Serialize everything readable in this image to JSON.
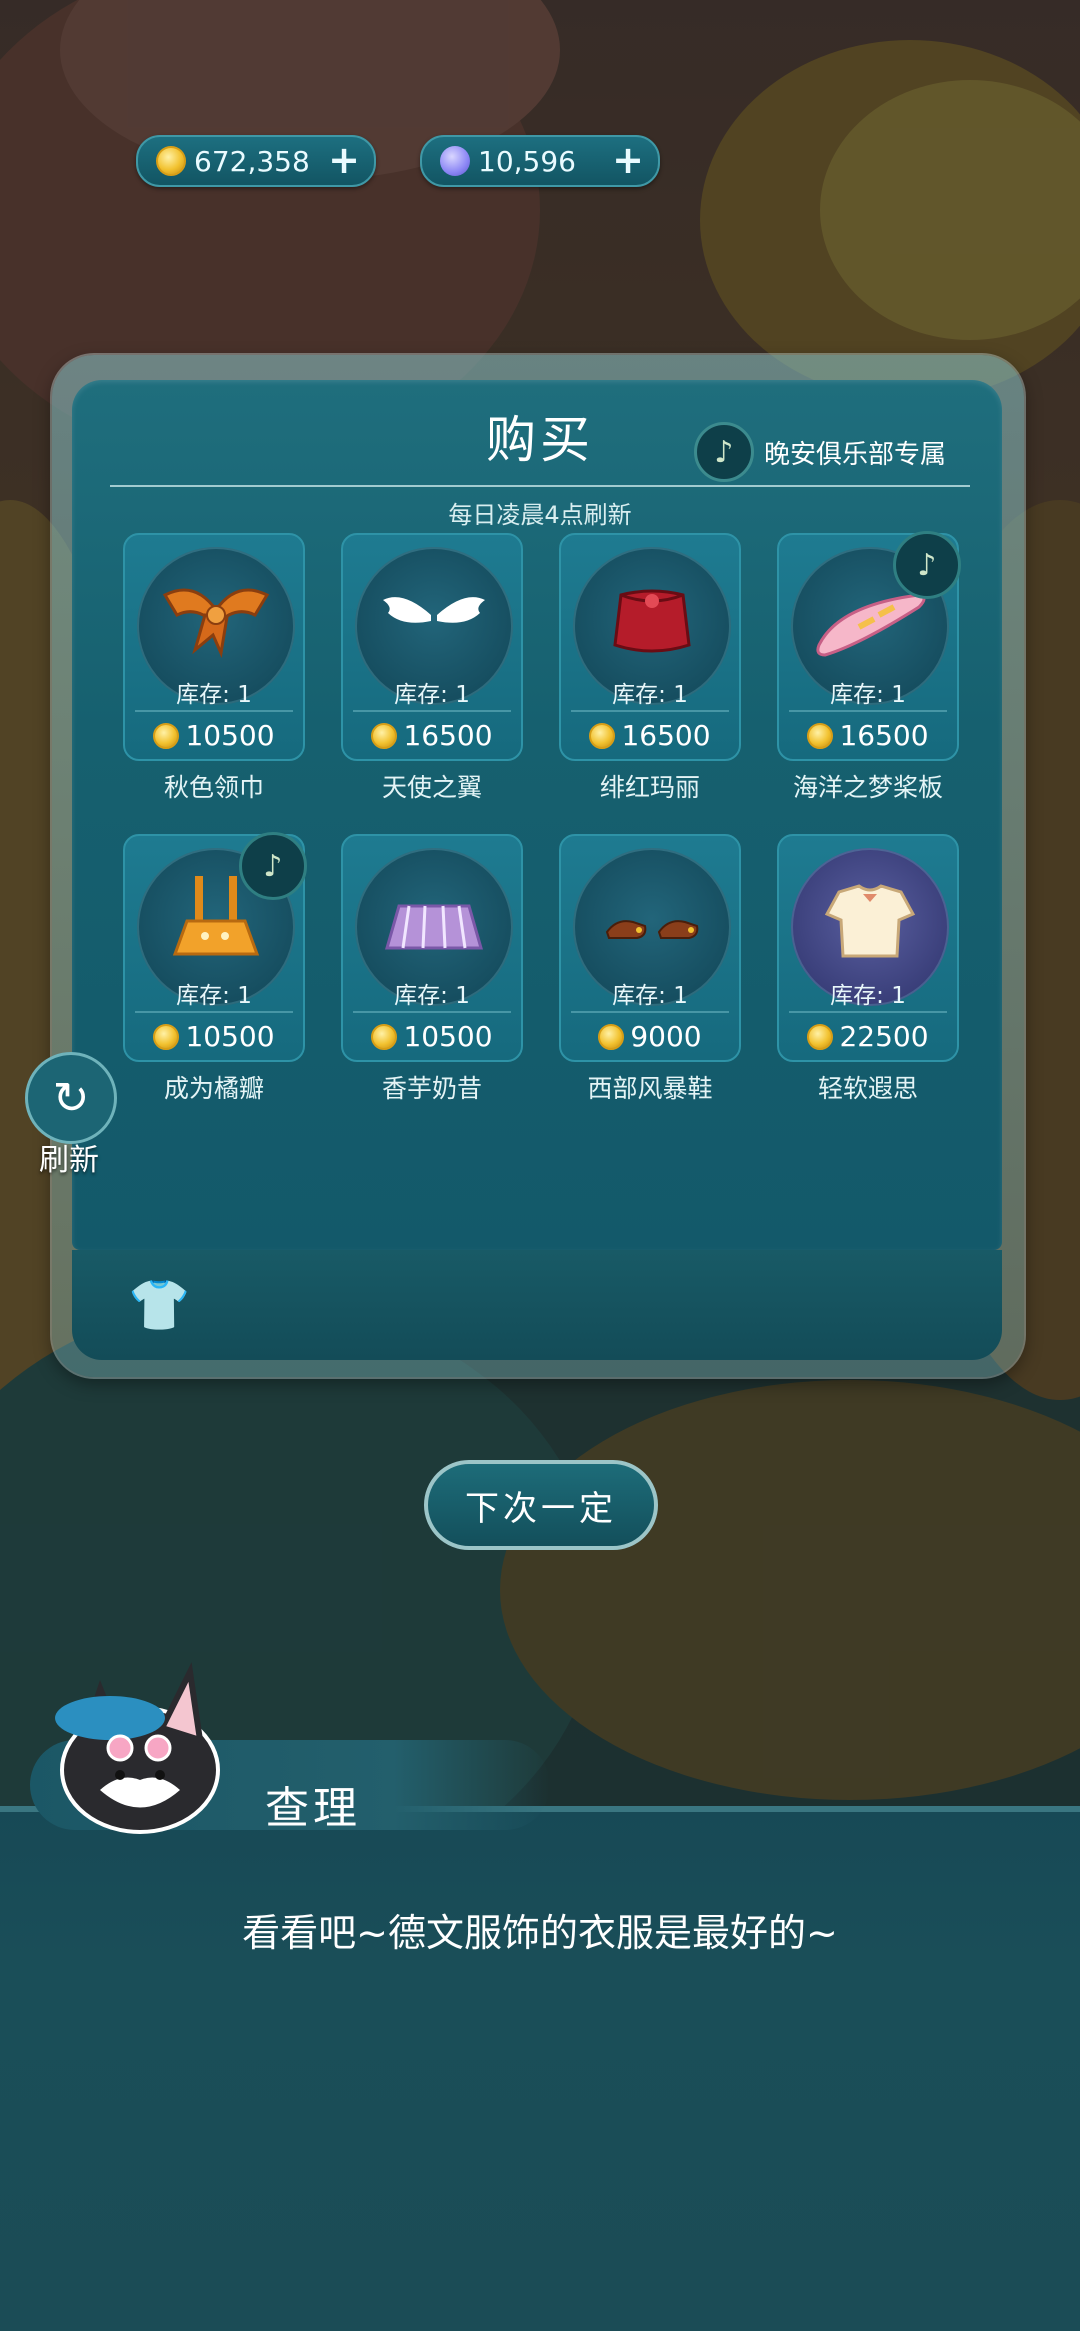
{
  "currency": {
    "coins": "672,358",
    "moons": "10,596"
  },
  "shop": {
    "title": "购买",
    "club_label": "晚安俱乐部专属",
    "refresh_note": "每日凌晨4点刷新",
    "items": [
      {
        "name": "秋色领巾",
        "stock": "库存: 1",
        "price": "10500",
        "club": false,
        "icon": "orange-scarf-icon"
      },
      {
        "name": "天使之翼",
        "stock": "库存: 1",
        "price": "16500",
        "club": false,
        "icon": "angel-wings-icon"
      },
      {
        "name": "绯红玛丽",
        "stock": "库存: 1",
        "price": "16500",
        "club": false,
        "icon": "red-bag-icon"
      },
      {
        "name": "海洋之梦桨板",
        "stock": "库存: 1",
        "price": "16500",
        "club": true,
        "icon": "paddleboard-icon"
      },
      {
        "name": "成为橘瓣",
        "stock": "库存: 1",
        "price": "10500",
        "club": true,
        "icon": "orange-overall-skirt-icon"
      },
      {
        "name": "香芋奶昔",
        "stock": "库存: 1",
        "price": "10500",
        "club": false,
        "icon": "purple-skirt-icon"
      },
      {
        "name": "西部风暴鞋",
        "stock": "库存: 1",
        "price": "9000",
        "club": false,
        "icon": "brown-shoes-icon"
      },
      {
        "name": "轻软遐思",
        "stock": "库存: 1",
        "price": "22500",
        "club": false,
        "icon": "cream-blouse-icon"
      }
    ]
  },
  "side": {
    "refresh_label": "刷新"
  },
  "buttons": {
    "next_time": "下次一定"
  },
  "dialog": {
    "speaker": "查理",
    "text": "看看吧~德文服饰的衣服是最好的~"
  },
  "colors": {
    "teal": "#1e7b91",
    "coin": "#f2c230",
    "moon": "#8b86f5"
  }
}
